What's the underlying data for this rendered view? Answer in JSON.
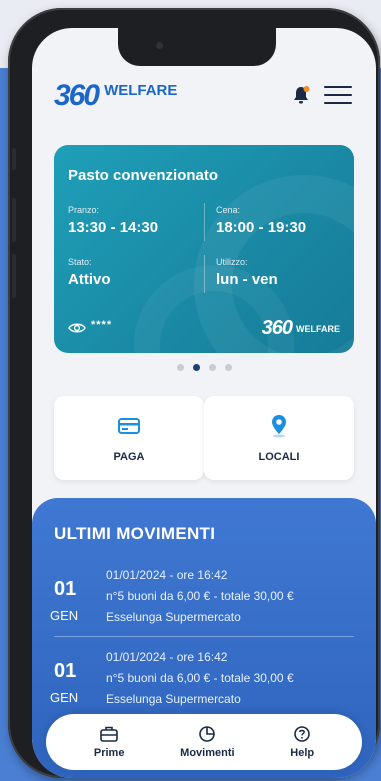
{
  "header": {
    "logo_number": "360",
    "logo_word": "WELFARE",
    "bell_icon": "bell-icon",
    "menu_icon": "hamburger-menu-icon"
  },
  "card": {
    "title": "Pasto convenzionato",
    "lunch_label": "Pranzo:",
    "lunch_value": "13:30 - 14:30",
    "dinner_label": "Cena:",
    "dinner_value": "18:00 - 19:30",
    "status_label": "Stato:",
    "status_value": "Attivo",
    "usage_label": "Utilizzo:",
    "usage_value": "lun - ven",
    "masked": "****",
    "logo_number": "360",
    "logo_word": "WELFARE",
    "color": "#1f9fb8"
  },
  "carousel": {
    "count": 4,
    "active": 1
  },
  "actions": {
    "pay_label": "PAGA",
    "pay_icon": "card-icon",
    "places_label": "LOCALI",
    "places_icon": "location-pin-icon"
  },
  "movements": {
    "title": "ULTIMI MOVIMENTI",
    "items": [
      {
        "day": "01",
        "month": "GEN",
        "datetime": "01/01/2024 - ore 16:42",
        "detail": "n°5 buoni da 6,00 € - totale 30,00 €",
        "merchant": "Esselunga Supermercato"
      },
      {
        "day": "01",
        "month": "GEN",
        "datetime": "01/01/2024 - ore 16:42",
        "detail": "n°5 buoni da 6,00 € - totale 30,00 €",
        "merchant": "Esselunga Supermercato"
      }
    ]
  },
  "tabbar": {
    "tabs": [
      {
        "label": "Prime",
        "icon": "briefcase-icon"
      },
      {
        "label": "Movimenti",
        "icon": "pie-chart-icon"
      },
      {
        "label": "Help",
        "icon": "help-circle-icon"
      }
    ]
  },
  "colors": {
    "brand_blue": "#1c66c9",
    "background_blue": "#4a7fd4",
    "movements_blue": "#3f78d2",
    "accent_orange": "#f28c28"
  }
}
